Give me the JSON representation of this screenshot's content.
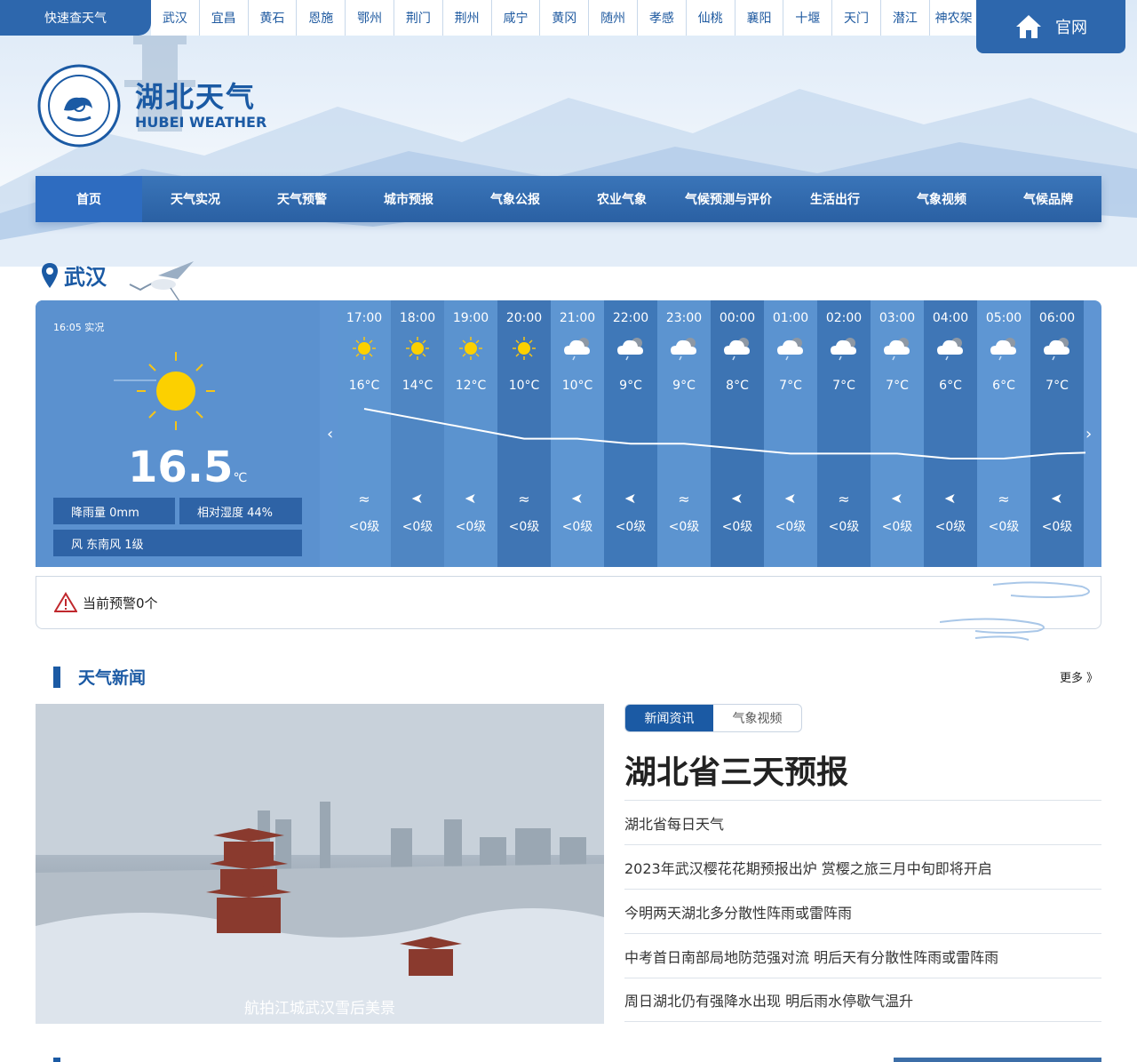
{
  "topbar": {
    "quick_label": "快速查天气",
    "cities": [
      "武汉",
      "宜昌",
      "黄石",
      "恩施",
      "鄂州",
      "荆门",
      "荆州",
      "咸宁",
      "黄冈",
      "随州",
      "孝感",
      "仙桃",
      "襄阳",
      "十堰",
      "天门",
      "潜江",
      "神农架"
    ],
    "official_label": "官网"
  },
  "brand": {
    "cn": "湖北天气",
    "en": "HUBEI WEATHER"
  },
  "nav": [
    "首页",
    "天气实况",
    "天气预警",
    "城市预报",
    "气象公报",
    "农业气象",
    "气候预测与评价",
    "生活出行",
    "气象视频",
    "气候品牌"
  ],
  "location": "武汉",
  "current": {
    "time_label": "16:05 实况",
    "temperature": "16.5",
    "unit": "℃",
    "rain": "降雨量 0mm",
    "humidity": "相对湿度 44%",
    "wind": "风 东南风 1级"
  },
  "arrows": {
    "prev": "‹",
    "next": "›"
  },
  "hourly": [
    {
      "time": "17:00",
      "icon": "sun-icon",
      "temp": "16°C",
      "wind_icon": "wave-icon",
      "wind": "<0级"
    },
    {
      "time": "18:00",
      "icon": "sun-icon",
      "temp": "14°C",
      "wind_icon": "arrow-icon",
      "wind": "<0级"
    },
    {
      "time": "19:00",
      "icon": "sun-icon",
      "temp": "12°C",
      "wind_icon": "arrow-icon",
      "wind": "<0级"
    },
    {
      "time": "20:00",
      "icon": "sun-icon",
      "temp": "10°C",
      "wind_icon": "wave-icon",
      "wind": "<0级"
    },
    {
      "time": "21:00",
      "icon": "cloud-rain-icon",
      "temp": "10°C",
      "wind_icon": "arrow-icon",
      "wind": "<0级"
    },
    {
      "time": "22:00",
      "icon": "cloud-rain-icon",
      "temp": "9°C",
      "wind_icon": "arrow-icon",
      "wind": "<0级"
    },
    {
      "time": "23:00",
      "icon": "cloud-rain-icon",
      "temp": "9°C",
      "wind_icon": "wave-icon",
      "wind": "<0级"
    },
    {
      "time": "00:00",
      "icon": "cloud-rain-icon",
      "temp": "8°C",
      "wind_icon": "arrow-icon",
      "wind": "<0级"
    },
    {
      "time": "01:00",
      "icon": "cloud-rain-icon",
      "temp": "7°C",
      "wind_icon": "arrow-icon",
      "wind": "<0级"
    },
    {
      "time": "02:00",
      "icon": "cloud-rain-icon",
      "temp": "7°C",
      "wind_icon": "wave-icon",
      "wind": "<0级"
    },
    {
      "time": "03:00",
      "icon": "cloud-rain-icon",
      "temp": "7°C",
      "wind_icon": "arrow-icon",
      "wind": "<0级"
    },
    {
      "time": "04:00",
      "icon": "cloud-rain-icon",
      "temp": "6°C",
      "wind_icon": "arrow-icon",
      "wind": "<0级"
    },
    {
      "time": "05:00",
      "icon": "cloud-rain-icon",
      "temp": "6°C",
      "wind_icon": "wave-icon",
      "wind": "<0级"
    },
    {
      "time": "06:00",
      "icon": "cloud-rain-icon",
      "temp": "7°C",
      "wind_icon": "arrow-icon",
      "wind": "<0级"
    }
  ],
  "hourly_temps": [
    16,
    14,
    12,
    10,
    10,
    9,
    9,
    8,
    7,
    7,
    7,
    6,
    6,
    7
  ],
  "alert": "当前预警0个",
  "news": {
    "title": "天气新闻",
    "more": "更多 》",
    "photo_caption": "航拍江城武汉雪后美景",
    "tabs": [
      "新闻资讯",
      "气象视频"
    ],
    "headline": "湖北省三天预报",
    "items": [
      "湖北省每日天气",
      "2023年武汉樱花花期预报出炉 赏樱之旅三月中旬即将开启",
      "今明两天湖北多分散性阵雨或雷阵雨",
      "中考首日南部局地防范强对流 明后天有分散性阵雨或雷阵雨",
      "周日湖北仍有强降水出现 明后雨水停歇气温升"
    ]
  },
  "colors": {
    "brand": "#1b5aa4",
    "panel": "#5f95d3",
    "nav": "#2d67ad"
  }
}
